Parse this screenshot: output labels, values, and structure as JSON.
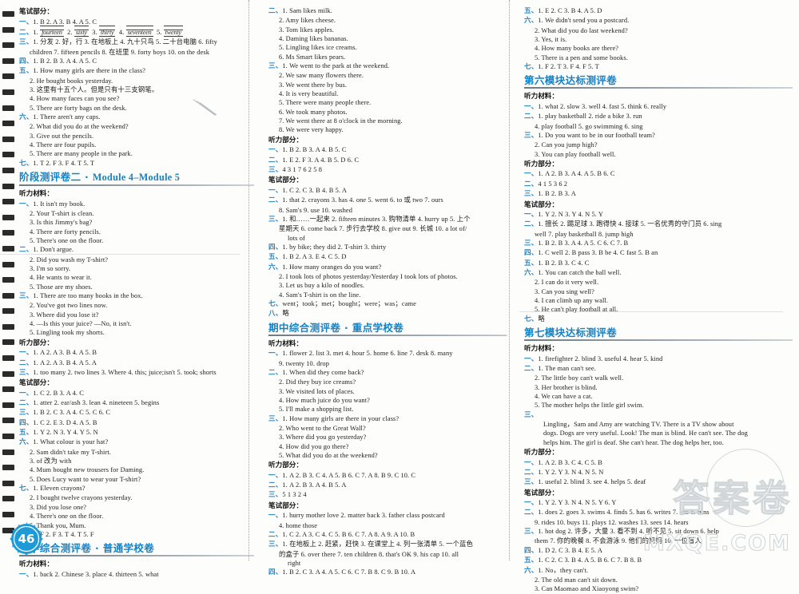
{
  "page": {
    "number": "46",
    "watermark_main": "答案卷",
    "watermark_url": "MXQE.COM"
  },
  "columns": [
    {
      "id": "col-1",
      "blocks": [
        {
          "type": "heading",
          "text": "笔试部分："
        },
        {
          "type": "line",
          "num": "一、",
          "text": "1. B   2. A   3. B   4. A   5. C"
        },
        {
          "type": "handwriting",
          "num": "二、",
          "items": [
            "1.",
            "fourteen",
            "2.",
            "sixty",
            "3.",
            "thirty",
            "4.",
            "seventeen",
            "5.",
            "twenty"
          ]
        },
        {
          "type": "line",
          "num": "三、",
          "text": "1. 分发   2. 好，行   3. 在地板上   4. 九十只鸟   5. 二十台电脑   6. fifty"
        },
        {
          "type": "cont",
          "text": "children   7. fifteen pencils   8. 在班里   9. forty boys   10. on the desk"
        },
        {
          "type": "line",
          "num": "四、",
          "text": "1. B   2. B   3. A   4. A   5. C"
        },
        {
          "type": "line",
          "num": "五、",
          "text": "1. How many girls are there in the class?"
        },
        {
          "type": "sub",
          "text": "2. He bought books yesterday."
        },
        {
          "type": "sub",
          "text": "3. 这里有十五个人。但是只有十三支钢笔。"
        },
        {
          "type": "sub",
          "text": "4. How many faces can you see?"
        },
        {
          "type": "sub",
          "text": "5. There are forty bags on the desk."
        },
        {
          "type": "line",
          "num": "六、",
          "text": "1. There aren't any caps."
        },
        {
          "type": "sub",
          "text": "2. What did you do at the weekend?"
        },
        {
          "type": "sub",
          "text": "3. Give out the pencils."
        },
        {
          "type": "sub",
          "text": "4. There are four pupils."
        },
        {
          "type": "sub",
          "text": "5. There are many people in the park."
        },
        {
          "type": "line",
          "num": "七、",
          "text": "1. T   2. F   3. F   4. T   5. T"
        },
        {
          "type": "title",
          "cn": "阶段测评卷二",
          "sep": " · ",
          "mod": "Module 4–Module 5"
        },
        {
          "type": "heading",
          "text": "听力材料："
        },
        {
          "type": "line",
          "num": "一、",
          "text": "1. It isn't my book."
        },
        {
          "type": "sub",
          "text": "2. Your T-shirt is clean."
        },
        {
          "type": "sub",
          "text": "3. Is this Jimmy's bag?"
        },
        {
          "type": "sub",
          "text": "4. There are forty pencils."
        },
        {
          "type": "sub",
          "text": "5. There's one on the floor."
        },
        {
          "type": "line",
          "num": "二、",
          "text": "1. Don't argue."
        },
        {
          "type": "sub",
          "text": "2. Did you wash my T-shirt?"
        },
        {
          "type": "sub",
          "text": "3. I'm so sorry."
        },
        {
          "type": "sub",
          "text": "4. He wants to wear it."
        },
        {
          "type": "sub",
          "text": "5. Those are my shoes."
        },
        {
          "type": "line",
          "num": "三、",
          "text": "1. There are too many books in the box."
        },
        {
          "type": "sub",
          "text": "2. You've got two lines now."
        },
        {
          "type": "sub",
          "text": "3. Where did you lose it?"
        },
        {
          "type": "sub",
          "text": "4. —Is this your juice?  —No, it isn't."
        },
        {
          "type": "sub",
          "text": "5. Lingling took my shorts."
        },
        {
          "type": "heading",
          "text": "听力部分："
        },
        {
          "type": "line",
          "num": "一、",
          "text": "1. A   2. A   3. B   4. A   5. B"
        },
        {
          "type": "line",
          "num": "二、",
          "text": "1. A   2. A   3. B   4. A   5. A"
        },
        {
          "type": "line",
          "num": "三、",
          "text": "1. too many   2. two lines   3. Where   4. this; juice;isn't   5. took; shorts"
        },
        {
          "type": "heading",
          "text": "笔试部分："
        },
        {
          "type": "line",
          "num": "一、",
          "text": "1. C   2. B   3. A   4. C"
        },
        {
          "type": "line",
          "num": "二、",
          "text": "1. atter   2. ear/ash   3. lean   4. nineteen   5. begins"
        },
        {
          "type": "line",
          "num": "三、",
          "text": "1. B   2. C   3. A   4. C   5. C   6. C"
        },
        {
          "type": "line",
          "num": "四、",
          "text": "1. C   2. E   3. D   4. A   5. B"
        },
        {
          "type": "line",
          "num": "五、",
          "text": "1. Y   2. N   3. Y   4. Y   5. N"
        },
        {
          "type": "line",
          "num": "六、",
          "text": "1. What colour is your hat?"
        },
        {
          "type": "sub",
          "text": "2. Sam didn't take my T-shirt."
        },
        {
          "type": "sub",
          "text": "3. of 改为 with"
        },
        {
          "type": "sub",
          "text": "4. Mum bought new trousers for Daming."
        },
        {
          "type": "sub",
          "text": "5. Does Lucy want to wear your T-shirt?"
        },
        {
          "type": "line",
          "num": "七、",
          "text": "1. Eleven crayons?"
        },
        {
          "type": "sub",
          "text": "2. I bought twelve crayons yesterday."
        },
        {
          "type": "sub",
          "text": "3. Did you lose one?"
        },
        {
          "type": "sub",
          "text": "4. There's one on the floor."
        },
        {
          "type": "sub",
          "text": "5. Thank you, Mum."
        },
        {
          "type": "line",
          "num": "八、",
          "text": "1. F   2. F   3. T   4. T   5. F"
        },
        {
          "type": "title",
          "cn": "期中综合测评卷",
          "sep": " · ",
          "mod2": "普通学校卷"
        },
        {
          "type": "heading",
          "text": "听力材料："
        },
        {
          "type": "line",
          "num": "一、",
          "text": "1. back   2. Chinese   3. place   4. thirteen   5. what"
        }
      ]
    },
    {
      "id": "col-2",
      "blocks": [
        {
          "type": "line",
          "num": "二、",
          "text": "1. Sam likes milk."
        },
        {
          "type": "sub",
          "text": "2. Amy likes cheese."
        },
        {
          "type": "sub",
          "text": "3. Tom likes apples."
        },
        {
          "type": "sub",
          "text": "4. Daming likes bananas."
        },
        {
          "type": "sub",
          "text": "5. Lingling likes ice creams."
        },
        {
          "type": "sub",
          "text": "6. Ms Smart likes pears."
        },
        {
          "type": "line",
          "num": "三、",
          "text": "1. We went to the park at the weekend."
        },
        {
          "type": "sub",
          "text": "2. We saw many flowers there."
        },
        {
          "type": "sub",
          "text": "3. We went there by bus."
        },
        {
          "type": "sub",
          "text": "4. It is very beautiful."
        },
        {
          "type": "sub",
          "text": "5. There were many people there."
        },
        {
          "type": "sub",
          "text": "6. We took many photos."
        },
        {
          "type": "sub",
          "text": "7. We went there at 8 o'clock in the morning."
        },
        {
          "type": "sub",
          "text": "8. We were very happy."
        },
        {
          "type": "heading",
          "text": "听力部分："
        },
        {
          "type": "line",
          "num": "一、",
          "text": "1. B   2. B   3. A   4. B   5. C"
        },
        {
          "type": "line",
          "num": "二、",
          "text": "1. E   2. F   3. A   4. B   5. D   6. C"
        },
        {
          "type": "line",
          "num": "三、",
          "text": "4   3   1   7   6   2   5   8"
        },
        {
          "type": "heading",
          "text": "笔试部分："
        },
        {
          "type": "line",
          "num": "一、",
          "text": "1. C   2. C   3. B   4. B   5. A"
        },
        {
          "type": "line",
          "num": "二、",
          "text": "1. that   2. crayons   3. has   4. one   5. went   6. to 或 two   7. ours"
        },
        {
          "type": "cont",
          "text": "8. Sam's   9. use   10. washed"
        },
        {
          "type": "line",
          "num": "三、",
          "text": "1. 和……一起来   2. fifteen minutes   3. 购物清单   4. hurry up   5. 上个"
        },
        {
          "type": "cont",
          "text": "星期天   6. come back   7. 步行去学校   8. give out   9. 长城   10. a lot of/"
        },
        {
          "type": "cont2",
          "text": "lots of"
        },
        {
          "type": "line",
          "num": "四、",
          "text": "1. by bike; they did   2. T-shirt   3. thirty"
        },
        {
          "type": "line",
          "num": "五、",
          "text": "1. B   2. A   3. E   4. C   5. D"
        },
        {
          "type": "line",
          "num": "六、",
          "text": "1. How many oranges do you want?"
        },
        {
          "type": "sub",
          "text": "2. I took lots of photos yesterday/Yesterday I took lots of photos."
        },
        {
          "type": "sub",
          "text": "3. Let us buy a kilo of noodles."
        },
        {
          "type": "sub",
          "text": "4. Sam's T-shirt is on the line."
        },
        {
          "type": "line",
          "num": "七、",
          "text": "went；took；met；bought；were；was；came"
        },
        {
          "type": "line",
          "num": "八、",
          "text": "略"
        },
        {
          "type": "title",
          "cn": "期中综合测评卷",
          "sep": " · ",
          "mod2": "重点学校卷"
        },
        {
          "type": "heading",
          "text": "听力材料："
        },
        {
          "type": "line",
          "num": "一、",
          "text": "1. flower   2. list   3. met   4. hour   5. home   6. line   7. desk   8. many"
        },
        {
          "type": "cont",
          "text": "9. twenty   10. drop"
        },
        {
          "type": "line",
          "num": "二、",
          "text": "1. When did they come back?"
        },
        {
          "type": "sub",
          "text": "2. Did they buy ice creams?"
        },
        {
          "type": "sub",
          "text": "3. We visited lots of places."
        },
        {
          "type": "sub",
          "text": "4. How much juice do you want?"
        },
        {
          "type": "sub",
          "text": "5. I'll make a shopping list."
        },
        {
          "type": "line",
          "num": "三、",
          "text": "1. How many girls are there in your class?"
        },
        {
          "type": "sub",
          "text": "2. Who went to the Great Wall?"
        },
        {
          "type": "sub",
          "text": "3. Where did you go yesterday?"
        },
        {
          "type": "sub",
          "text": "4. How did you go there?"
        },
        {
          "type": "sub",
          "text": "5. What did you do at the weekend?"
        },
        {
          "type": "heading",
          "text": "听力部分："
        },
        {
          "type": "line",
          "num": "一、",
          "text": "1. A   2. B   3. C   4. A   5. B   6. C   7. A   8. B   9. C   10. C"
        },
        {
          "type": "line",
          "num": "二、",
          "text": "1. A   2. B   3. A   4. B   5. A"
        },
        {
          "type": "line",
          "num": "三、",
          "text": "5   1   3   2   4"
        },
        {
          "type": "heading",
          "text": "笔试部分："
        },
        {
          "type": "line",
          "num": "一、",
          "text": "1. hurry    mother    love   2. matter    back   3. father    class    postcard"
        },
        {
          "type": "cont",
          "text": "4. home    those"
        },
        {
          "type": "line",
          "num": "二、",
          "text": "1. C   2. A   3. C   4. C   5. B   6. C   7. A   8. A   9. A   10. B"
        },
        {
          "type": "line",
          "num": "三、",
          "text": "1. 在地板上   2. 赶紧，赶快   3. 在课堂上   4. 列一张清单   5. 一个蓝色"
        },
        {
          "type": "cont",
          "text": "的盒子   6. over there   7. ten children   8. that's OK   9. his cap   10. all"
        },
        {
          "type": "cont2",
          "text": "right"
        },
        {
          "type": "line",
          "num": "四、",
          "text": "1. B   2. C   3. A   4. A   5. C   6. C   7. B   8. C   9. B   10. A"
        }
      ]
    },
    {
      "id": "col-3",
      "blocks": [
        {
          "type": "line",
          "num": "五、",
          "text": "1. E   2. C   3. B   4. A   5. D"
        },
        {
          "type": "line",
          "num": "六、",
          "text": "1. We didn't send you a postcard."
        },
        {
          "type": "sub",
          "text": "2. What did you do last weekend?"
        },
        {
          "type": "sub",
          "text": "3. Yes, it is."
        },
        {
          "type": "sub",
          "text": "4. How many books are there?"
        },
        {
          "type": "sub",
          "text": "5. There is a pen and some books."
        },
        {
          "type": "line",
          "num": "七、",
          "text": "1. F   2. T   3. F   4. F   5. T"
        },
        {
          "type": "title",
          "cn": "第六模块达标测评卷"
        },
        {
          "type": "heading",
          "text": "听力材料："
        },
        {
          "type": "line",
          "num": "一、",
          "text": "1. what   2. slow   3. well   4. fast   5. think   6. really"
        },
        {
          "type": "line",
          "num": "二、",
          "text": "1. play basketball   2. ride a bike   3. run"
        },
        {
          "type": "cont",
          "text": "4. play football   5. go swimming   6. sing"
        },
        {
          "type": "line",
          "num": "三、",
          "text": "1. Do you want to be in our football team?"
        },
        {
          "type": "sub",
          "text": "2. Can you jump high?"
        },
        {
          "type": "sub",
          "text": "3. You can play football well."
        },
        {
          "type": "heading",
          "text": "听力部分："
        },
        {
          "type": "line",
          "num": "一、",
          "text": "1. A   2. B   3. A   4. A   5. B   6. C"
        },
        {
          "type": "line",
          "num": "二、",
          "text": "4   1   5   3   6   2"
        },
        {
          "type": "line",
          "num": "三、",
          "text": "1. B   2. B   3. A"
        },
        {
          "type": "heading",
          "text": "笔试部分："
        },
        {
          "type": "line",
          "num": "一、",
          "text": "1. Y   2. N   3. Y   4. N   5. Y"
        },
        {
          "type": "line",
          "num": "二、",
          "text": "1. 擅长   2. 踢足球   3. 跑得快   4. 接球   5. 一名优秀的守门员   6. sing"
        },
        {
          "type": "cont",
          "text": "well   7. play basketball   8. jump high"
        },
        {
          "type": "line",
          "num": "三、",
          "text": "1. B   2. B   3. A   4. A   5. C   6. C   7. B"
        },
        {
          "type": "line",
          "num": "四、",
          "text": "1. C   well   2. B   pass   3. B   be   4. C   fast   5. B   an"
        },
        {
          "type": "line",
          "num": "五、",
          "text": "1. B   2. B   3. C   4. C"
        },
        {
          "type": "line",
          "num": "六、",
          "text": "1. You can catch the ball well."
        },
        {
          "type": "sub",
          "text": "2. I can do it very well."
        },
        {
          "type": "sub",
          "text": "3. Can you sing well?"
        },
        {
          "type": "sub",
          "text": "4. I can climb up any wall."
        },
        {
          "type": "sub",
          "text": "5. He can't play football at all."
        },
        {
          "type": "line",
          "num": "七、",
          "text": "略"
        },
        {
          "type": "title",
          "cn": "第七模块达标测评卷"
        },
        {
          "type": "heading",
          "text": "听力材料："
        },
        {
          "type": "line",
          "num": "一、",
          "text": "1. firefighter   2. blind   3. useful   4. hear   5. kind"
        },
        {
          "type": "line",
          "num": "二、",
          "text": "1. The man can't see."
        },
        {
          "type": "sub",
          "text": "2. The little boy can't walk well."
        },
        {
          "type": "sub",
          "text": "3. Her brother is blind."
        },
        {
          "type": "sub",
          "text": "4. We can have a cat."
        },
        {
          "type": "sub",
          "text": "5. The mother helps the little girl swim."
        },
        {
          "type": "line",
          "num": "三、",
          "text": ""
        },
        {
          "type": "para",
          "text": "Lingling，Sam and Amy are watching TV. There is a TV show about"
        },
        {
          "type": "cont2",
          "text": "dogs. Dogs are very useful. Look! The man is blind. He can't see. The dog"
        },
        {
          "type": "cont2",
          "text": "helps him. The girl is deaf. She can't hear. The dog helps her, too."
        },
        {
          "type": "heading",
          "text": "听力部分："
        },
        {
          "type": "line",
          "num": "一、",
          "text": "1. A   2. B   3. C   4. C   5. B"
        },
        {
          "type": "line",
          "num": "二、",
          "text": "1. Y   2. Y   3. N   4. N   5. N"
        },
        {
          "type": "line",
          "num": "三、",
          "text": "1. useful   2. blind   3. see   4. helps   5. deaf"
        },
        {
          "type": "heading",
          "text": "笔试部分："
        },
        {
          "type": "line",
          "num": "一、",
          "text": "1. Y   2. Y   3. N   4. N   5. Y   6. Y"
        },
        {
          "type": "line",
          "num": "二、",
          "text": "1. does   2. goes   3. swims   4. finds   5. has   6. writes   7. sits   8. runs"
        },
        {
          "type": "cont",
          "text": "9. rides   10. buys   11. plays   12. washes   13. sees   14. hears"
        },
        {
          "type": "line",
          "num": "三、",
          "text": "1. hot dog   2. 许多，大量   3. 看不到   4. 听不见   5. sit down   6. help"
        },
        {
          "type": "cont",
          "text": "them   7. 你的晚餐   8. 不会游泳   9. 他们的妈妈   10. 一位盲人"
        },
        {
          "type": "line",
          "num": "四、",
          "text": "1. D   2. C   3. B   4. E   5. A"
        },
        {
          "type": "line",
          "num": "五、",
          "text": "1. C   2. C   3. B   4. A   5. B   6. C   7. B   8. B"
        },
        {
          "type": "line",
          "num": "六、",
          "text": "1. No，they can't."
        },
        {
          "type": "sub",
          "text": "2. The old man can't sit down."
        },
        {
          "type": "sub",
          "text": "3. Can Maomao and Xiaoyong swim?"
        }
      ]
    }
  ],
  "colors": {
    "accent_blue": "#1583c6",
    "num_blue": "#1f7fc0",
    "ink": "#1c1c1c"
  }
}
